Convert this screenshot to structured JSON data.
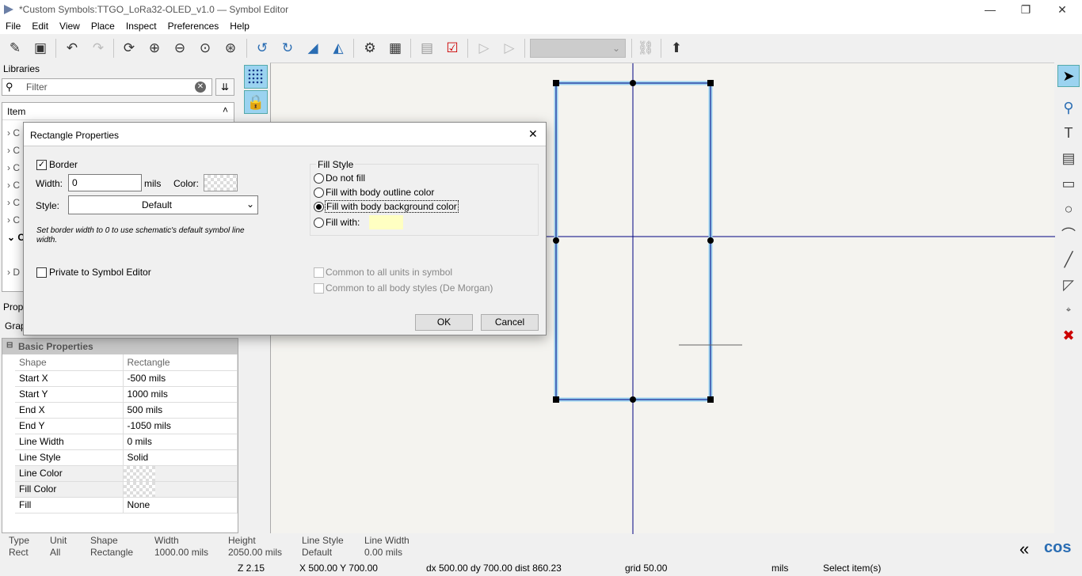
{
  "window": {
    "title": "*Custom Symbols:TTGO_LoRa32-OLED_v1.0 — Symbol Editor",
    "min": "—",
    "restore": "❐",
    "close": "✕"
  },
  "menu": [
    "File",
    "Edit",
    "View",
    "Place",
    "Inspect",
    "Preferences",
    "Help"
  ],
  "toolbar": {
    "icons": [
      "new-symbol-icon",
      "save-icon",
      "undo-icon",
      "redo-icon",
      "refresh-icon",
      "zoom-in-icon",
      "zoom-out-icon",
      "zoom-fit-icon",
      "zoom-selection-icon",
      "rotate-ccw-icon",
      "rotate-cw-icon",
      "mirror-vertical-icon",
      "mirror-horizontal-icon",
      "symbol-properties-icon",
      "pin-table-icon",
      "datasheet-icon",
      "check-symbol-icon",
      "body-style-1-icon",
      "body-style-2-icon",
      "unit-select",
      "sync-pins-icon",
      "update-symbol-icon"
    ]
  },
  "libraries": {
    "header": "Libraries",
    "filter_placeholder": "Filter",
    "column": "Item",
    "rows": [
      "C",
      "C",
      "C",
      "C",
      "C",
      "C",
      "C",
      "D"
    ]
  },
  "properties": {
    "header": "Prop",
    "tab": "Grap",
    "section": "Basic Properties",
    "rows": [
      [
        "Shape",
        "Rectangle"
      ],
      [
        "Start X",
        "-500 mils"
      ],
      [
        "Start Y",
        "1000 mils"
      ],
      [
        "End X",
        "500 mils"
      ],
      [
        "End Y",
        "-1050 mils"
      ],
      [
        "Line Width",
        "0 mils"
      ],
      [
        "Line Style",
        "Solid"
      ],
      [
        "Line Color",
        ""
      ],
      [
        "Fill Color",
        ""
      ],
      [
        "Fill",
        "None"
      ]
    ]
  },
  "dialog": {
    "title": "Rectangle Properties",
    "close": "✕",
    "border_label": "Border",
    "width_label": "Width:",
    "width_value": "0",
    "width_unit": "mils",
    "color_label": "Color:",
    "style_label": "Style:",
    "style_value": "Default",
    "hint": "Set border width to 0 to use schematic's default symbol line width.",
    "private_label": "Private to Symbol Editor",
    "fill_group": "Fill Style",
    "fill_options": [
      "Do not fill",
      "Fill with body outline color",
      "Fill with body background color",
      "Fill with:"
    ],
    "fill_selected": 2,
    "fill_color": "#ffffc2",
    "common_units": "Common to all units in symbol",
    "common_styles": "Common to all body styles (De Morgan)",
    "ok": "OK",
    "cancel": "Cancel"
  },
  "status": {
    "labels": [
      "Type",
      "Unit",
      "Shape",
      "Width",
      "Height",
      "Line Style",
      "Line Width"
    ],
    "values": [
      "Rect",
      "All",
      "Rectangle",
      "1000.00 mils",
      "2050.00 mils",
      "Default",
      "0.00 mils"
    ],
    "zoom": "Z 2.15",
    "xy": "X 500.00  Y 700.00",
    "delta": "dx 500.00  dy 700.00  dist 860.23",
    "grid": "grid 50.00",
    "units": "mils",
    "action": "Select item(s)",
    "logo": "cos"
  },
  "colors": {
    "accent": "#9bd3f0",
    "wire": "#000080",
    "canvas": "#f4f3ef"
  }
}
